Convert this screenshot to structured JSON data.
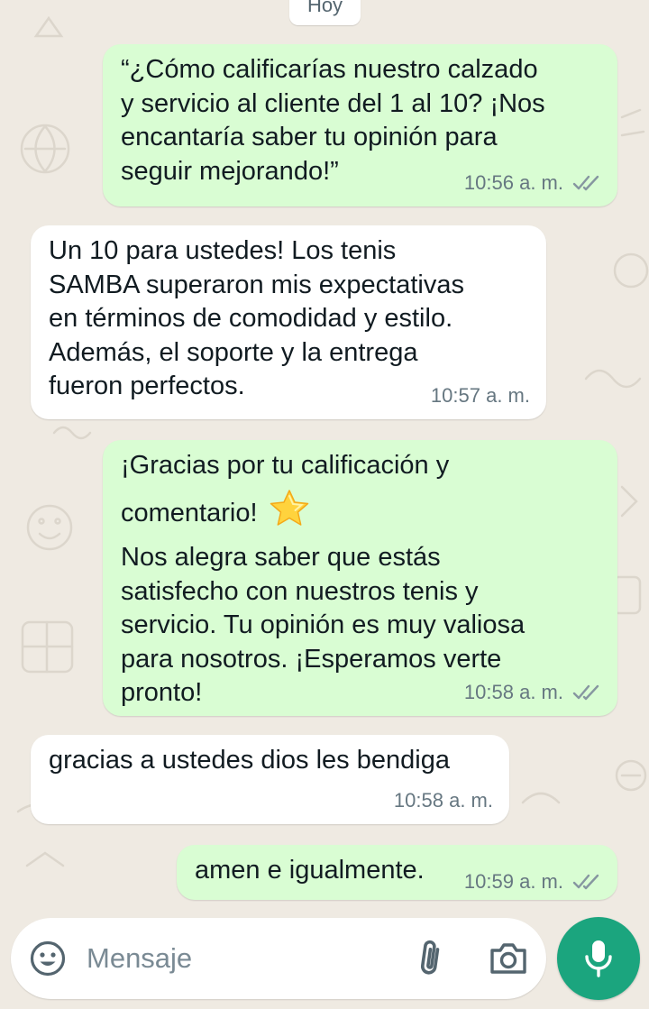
{
  "chat": {
    "date_chip": "Hoy",
    "messages": [
      {
        "direction": "outgoing",
        "lines": [
          "“¿Cómo calificarías nuestro calzado",
          "y servicio al cliente del 1 al 10? ¡Nos",
          "encantaría saber tu opinión para",
          "seguir mejorando!”"
        ],
        "time": "10:56 a. m.",
        "status": "read"
      },
      {
        "direction": "incoming",
        "lines": [
          "Un 10 para ustedes! Los tenis",
          "SAMBA superaron mis expectativas",
          "en términos de comodidad y estilo.",
          "Además, el soporte y la entrega",
          "fueron perfectos."
        ],
        "time": "10:57 a. m."
      },
      {
        "direction": "outgoing",
        "lines": [
          "¡Gracias por tu calificación y",
          "comentario!",
          "Nos alegra saber que estás",
          "satisfecho con nuestros tenis y",
          "servicio. Tu opinión es muy valiosa",
          "para nosotros. ¡Esperamos verte",
          "pronto!"
        ],
        "emoji": "star-emoji",
        "time": "10:58 a. m.",
        "status": "read"
      },
      {
        "direction": "incoming",
        "lines": [
          "gracias a ustedes dios les bendiga"
        ],
        "time": "10:58 a. m."
      },
      {
        "direction": "outgoing",
        "lines": [
          "amen e igualmente."
        ],
        "time": "10:59 a. m.",
        "status": "read"
      }
    ]
  },
  "composer": {
    "placeholder": "Mensaje",
    "value": "",
    "icons": [
      "emoji-icon",
      "paperclip-icon",
      "camera-icon",
      "microphone-icon"
    ]
  },
  "colors": {
    "wallpaper": "#efeae2",
    "outgoing_bubble": "#d9fdd3",
    "incoming_bubble": "#ffffff",
    "mic_button": "#1ba57e",
    "meta_text": "#667781"
  }
}
